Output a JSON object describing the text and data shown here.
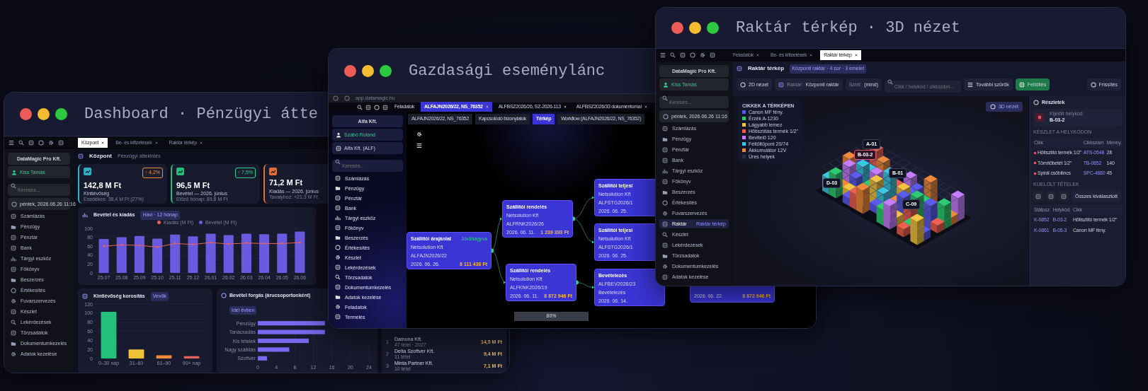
{
  "dashboard": {
    "title": "Dashboard · Pénzügyi átte",
    "tabs": [
      {
        "label": "Központ",
        "selected": true
      },
      {
        "label": "Be- és kifizetések",
        "selected": false
      },
      {
        "label": "Raktár térkép",
        "selected": false
      }
    ],
    "company": "DataMagic Pro Kft.",
    "user": "Kiss Tamás",
    "search": {
      "placeholder": "Keresés..."
    },
    "date": "péntek, 2026.06.26 11:16",
    "menu": [
      "Számlázás",
      "Pénzügy",
      "Pénztár",
      "Bank",
      "Tárgyi eszköz",
      "Főkönyv",
      "Beszerzés",
      "Értékesítés",
      "Fuvarszervezés",
      "Készlet",
      "Lekérdezések",
      "Törzsadatok",
      "Dokumentumkezelés",
      "Adatok kezelése"
    ],
    "header": {
      "title": "Központ",
      "subtitle": "Pénzügyi áttekintés"
    },
    "kpis": [
      {
        "value": "142,8 M Ft",
        "label": "Kintlévőség",
        "note": "Esedékes: 38,4 M Ft (27%)",
        "badge": {
          "text": "↑ 4,2%",
          "color": "#f08a3a"
        },
        "color": "#2bb3c0"
      },
      {
        "value": "96,5 M Ft",
        "label": "Bevétel — 2026. június",
        "note": "Előző hónap: 89,8 M Ft",
        "badge": {
          "text": "↑ 7,5%",
          "color": "#2fd28a"
        },
        "color": "#22c07a"
      },
      {
        "value": "71,2 M Ft",
        "label": "Kiadás — 2026. június",
        "note": "Tavalyhoz: +21,3 M Ft",
        "color": "#e0703a"
      }
    ],
    "revenue_card": {
      "title": "Bevétel és kiadás",
      "tag": "Havi · 12 hónap",
      "chart_data": {
        "type": "bar",
        "categories": [
          "25.07",
          "25.08",
          "25.09",
          "25.10",
          "25.11",
          "25.12",
          "26.01",
          "26.02",
          "26.03",
          "26.04",
          "26.05",
          "26.06"
        ],
        "series": [
          {
            "name": "Bevétel (M Ft)",
            "type": "bar",
            "color": "#6a5ae0",
            "values": [
              76,
              80,
              83,
              77,
              86,
              82,
              88,
              85,
              88,
              87,
              88,
              93
            ]
          },
          {
            "name": "Kiadás (M Ft)",
            "type": "line",
            "color": "#e8645a",
            "values": [
              60,
              63,
              62,
              58,
              66,
              64,
              68,
              65,
              67,
              66,
              66,
              68
            ]
          }
        ],
        "ylim": [
          0,
          100
        ],
        "yticks": [
          0,
          20,
          40,
          60,
          80,
          100
        ],
        "grid": true
      }
    },
    "aging_card": {
      "title": "Kintlévőség korosítás",
      "tag": "Vevők",
      "chart_data": {
        "type": "bar",
        "categories": [
          "0–30 nap",
          "31–60",
          "61–90",
          "90+ nap"
        ],
        "series": [
          {
            "color": "#22c07a",
            "values": [
              103,
              null,
              null,
              null
            ]
          },
          {
            "color": "#f0c23a",
            "values": [
              null,
              20,
              null,
              null
            ]
          },
          {
            "color": "#f08a3a",
            "values": [
              null,
              null,
              7,
              null
            ]
          },
          {
            "color": "#e8645a",
            "values": [
              null,
              null,
              null,
              5
            ]
          }
        ],
        "ylim": [
          0,
          120
        ],
        "yticks": [
          0,
          20,
          40,
          60,
          80,
          100,
          120
        ],
        "grid": true
      }
    },
    "sales_card": {
      "title": "Bevétel forgás (árucsoportonként)",
      "tag": "Idei évben",
      "chart_data": {
        "type": "bar",
        "orientation": "horizontal",
        "categories": [
          "Pénzügy",
          "Tanácsadás",
          "Kis tételek",
          "Nagy szállítás",
          "Szoftver"
        ],
        "series": [
          {
            "color": "#7b68ee",
            "values": [
              14.5,
              14.5,
              11,
              6.8,
              2
            ]
          }
        ],
        "xlim": [
          0,
          24
        ],
        "xticks": [
          0,
          4,
          8,
          12,
          16,
          20,
          24
        ],
        "grid": true
      }
    },
    "top_clients": [
      {
        "rank": "1",
        "name": "Damona Kft.",
        "sub": "47 tétel · 2027",
        "amount": "14,5 M Ft"
      },
      {
        "rank": "2",
        "name": "Delta Szoftver Kft.",
        "sub": "11 tétel",
        "amount": "9,4 M Ft"
      },
      {
        "rank": "3",
        "name": "Minta Partner Kft.",
        "sub": "10 tétel",
        "amount": "7,1 M Ft"
      }
    ]
  },
  "chain": {
    "title": "Gazdasági eseménylánc",
    "url": "app.datamagic.hu",
    "tabs": [
      {
        "label": "Feladatok",
        "selected": false
      },
      {
        "label": "ALFAJN2026/22, NS_76352",
        "selected": true
      },
      {
        "label": "ALFBSZ2026/26, SZ-2026-113",
        "selected": false
      },
      {
        "label": "ALFBSZ2026/33 dokumentumai",
        "selected": false
      }
    ],
    "subtabs": [
      {
        "label": "ALFAJN2026/22, NS_76352",
        "selected": false
      },
      {
        "label": "Kapcsolódó bizonylatok",
        "selected": false
      },
      {
        "label": "Térkép",
        "selected": true
      },
      {
        "label": "Workflow (ALFAJN2026/22, NS_76352)",
        "selected": false
      }
    ],
    "company": "Alfa Kft.",
    "user": "Szabó Roland",
    "org": "Alfa Kft. (ALF)",
    "search": {
      "placeholder": "Keresés..."
    },
    "menu": [
      "Számlázás",
      "Pénzügy",
      "Pénztár",
      "Bank",
      "Tárgyi eszköz",
      "Főkönyv",
      "Beszerzés",
      "Értékesítés",
      "Készlet",
      "Lekérdezések",
      "Törzsadatok",
      "Dokumentumkezelés",
      "Adatok kezelése",
      "Feladatok",
      "Termelés"
    ],
    "nodes": [
      {
        "title": "Szállítói árajánlat",
        "status": "Jóváhagyva",
        "partner": "Netsolution Kft",
        "number": "ALFAJN2026/22",
        "date": "2026. 06. 26.",
        "amount": "8 111 438 Ft"
      },
      {
        "title": "Szállítói rendelés",
        "partner": "Netsolution Kft",
        "number": "ALFRNK2026/26",
        "date": "2026. 06. 11.",
        "amount": "1 239 393 Ft"
      },
      {
        "title": "Szállítói rendelés",
        "partner": "Netsolution Kft",
        "number": "ALFKNK2026/19",
        "date": "2026. 06. 11.",
        "amount": "8 872 946 Ft"
      },
      {
        "title": "Szállítói teljesí",
        "partner": "Netsolution Kft",
        "number": "ALFSTG2026/1",
        "date": "2026. 06. 25."
      },
      {
        "title": "Szállítói teljesí",
        "partner": "Netsolution Kft",
        "number": "ALFSTG2026/1",
        "date": "2026. 06. 25."
      },
      {
        "title": "Bevételezés",
        "number": "ALFBEV2026/23",
        "partner": "Bevételezés",
        "date": "2026. 06. 14."
      },
      {
        "date": "2026. 06. 22.",
        "amount": "8 872 946 Ft"
      }
    ],
    "zoom": "80%"
  },
  "warehouse": {
    "title": "Raktár térkép · 3D nézet",
    "tabs": [
      {
        "label": "Feladatok",
        "selected": false
      },
      {
        "label": "Be- és kifizetések",
        "selected": false
      },
      {
        "label": "Raktár térkép",
        "selected": true
      }
    ],
    "company": "DataMagic Pro Kft.",
    "user": "Kiss Tamás",
    "search": {
      "placeholder": "Keresés..."
    },
    "date": "péntek, 2026.06.26 11:16",
    "menu": [
      {
        "label": "Számlázás",
        "selected": false
      },
      {
        "label": "Pénzügy",
        "selected": false
      },
      {
        "label": "Pénztár",
        "selected": false
      },
      {
        "label": "Bank",
        "selected": false
      },
      {
        "label": "Tárgyi eszköz",
        "selected": false
      },
      {
        "label": "Főkönyv",
        "selected": false
      },
      {
        "label": "Beszerzés",
        "selected": false
      },
      {
        "label": "Értékesítés",
        "selected": false
      },
      {
        "label": "Fuvarszervezés",
        "selected": false
      },
      {
        "label": "Raktár",
        "selected": true,
        "note": "Raktár térkép"
      },
      {
        "label": "Készlet",
        "selected": false
      },
      {
        "label": "Lekérdezések",
        "selected": false
      },
      {
        "label": "Törzsadatok",
        "selected": false
      },
      {
        "label": "Dokumentumkezelés",
        "selected": false
      },
      {
        "label": "Adatok kezelése",
        "selected": false
      }
    ],
    "header": {
      "title": "Raktár térkép",
      "chip": "Központi raktár · 4 sor · 3 emelet"
    },
    "toolbar": {
      "view": "2D nézet",
      "warehouse_label": "Raktár:",
      "warehouse": "Központi raktár",
      "level_label": "Szint:",
      "level": "(mind)",
      "search_placeholder": "Cikk / helykód / cikkszám...",
      "filters": "További szűrők",
      "upload": "Feltöltés",
      "refresh": "Frissítés"
    },
    "view_badge": "3D nézet",
    "legend": {
      "title": "CIKKEK A TÉRKÉPEN",
      "items": [
        {
          "label": "Canon MF fény.",
          "color": "#5b5bf0"
        },
        {
          "label": "Érzék A-1230",
          "color": "#2ecc71"
        },
        {
          "label": "Lágyabb lemez",
          "color": "#f4c542"
        },
        {
          "label": "Hőtisztítás termék 1/2\"",
          "color": "#f06050"
        },
        {
          "label": "Bevitelő 120",
          "color": "#c77dff"
        },
        {
          "label": "Féltöltőpont 20/74",
          "color": "#3cc8e0"
        },
        {
          "label": "Akkumulátor 12V",
          "color": "#f08a3a"
        },
        {
          "label": "Üres helyek",
          "color": "#2a2d48"
        }
      ]
    },
    "labels": [
      {
        "code": "A-01",
        "selected": false
      },
      {
        "code": "B-03-2",
        "selected": true
      },
      {
        "code": "B-01",
        "selected": false
      },
      {
        "code": "D-03",
        "selected": false
      },
      {
        "code": "C-09",
        "selected": false
      }
    ],
    "details": {
      "title": "Részletek",
      "caption": "Kijelölt helykód",
      "code": "B-03-2",
      "stock_title": "KÉSZLET A HELYKÓDON",
      "stock_columns": [
        "Cikk",
        "Cikkszám",
        "Menny."
      ],
      "stock_rows": [
        [
          "Hőtisztító termék 1/2\"",
          "ATS-0548",
          "28"
        ],
        [
          "Tömítőbetét 1/2\"",
          "TB-0852",
          "140"
        ],
        [
          "Spirál csőbilincs",
          "SPC-4880",
          "45"
        ]
      ],
      "moves_title": "KIJELÖLT TÉTELEK",
      "filter": "Összes kiválasztott",
      "moves_columns": [
        "Státusz",
        "Helykód",
        "Cikk"
      ],
      "moves_rows": [
        [
          "K-0852",
          "B-03-2",
          "Hőtisztító termék 1/2\""
        ],
        [
          "K-0861",
          "B-05-3",
          "Canon MF fény."
        ]
      ]
    }
  }
}
